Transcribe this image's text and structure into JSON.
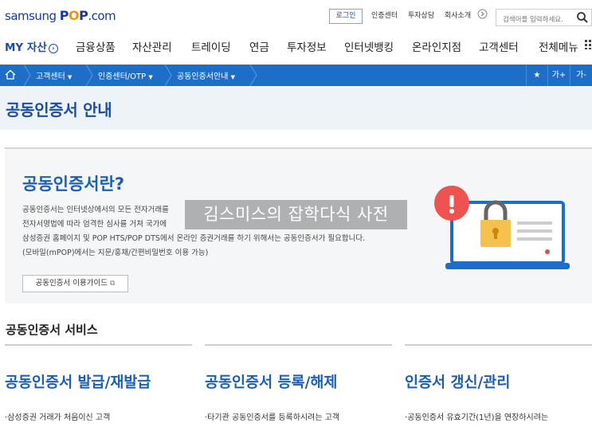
{
  "header": {
    "logo_prefix": "samsung ",
    "logo_p1": "P",
    "logo_o": "O",
    "logo_p2": "P",
    "logo_suffix": ".com",
    "login": "로그인",
    "util_links": [
      "인증센터",
      "투자상담",
      "회사소개"
    ],
    "search_placeholder": "검색어를 입력하세요."
  },
  "gnb": {
    "my_asset": "MY 자산",
    "items": [
      "금융상품",
      "자산관리",
      "트레이딩",
      "연금",
      "투자정보",
      "인터넷뱅킹",
      "온라인지점",
      "고객센터",
      "전체메뉴"
    ]
  },
  "breadcrumb": {
    "items": [
      "고객센터",
      "인증센터/OTP",
      "공동인증서안내"
    ],
    "font_up": "가+",
    "font_down": "가-"
  },
  "page": {
    "title": "공동인증서 안내"
  },
  "hero": {
    "title": "공동인증서란?",
    "line1": "공동인증서는 인터넷상에서의 모든 전자거래를",
    "line2": "전자서명법에 따라 엄격한 심사를 거쳐 국가에",
    "line3": "삼성증권 홈페이지 및 POP HTS/POP DTS에서 온라인 증권거래를 하기 위해서는 공동인증서가 필요합니다.",
    "line4": "(모바일(mPOP)에서는 지문/홍채/간편비밀번호 이용 가능)",
    "guide_button": "공동인증서 이용가이드",
    "watermark": "김스미스의 잡학다식 사전"
  },
  "services": {
    "section_title": "공동인증서 서비스",
    "columns": [
      {
        "title": "공동인증서 발급/재발급",
        "desc": "·삼성증권 거래가 처음이신 고객"
      },
      {
        "title": "공동인증서 등록/해제",
        "desc": "·타기관 공동인증서를 등록하시려는 고객"
      },
      {
        "title": "인증서 갱신/관리",
        "desc": "·공동인증서 유효기간(1년)을 연장하시려는"
      }
    ]
  },
  "colors": {
    "brand_blue": "#1b4ea2",
    "breadcrumb_bg": "#1c6ec7",
    "accent_orange": "#f29500",
    "hero_title": "#1c5fb0"
  }
}
